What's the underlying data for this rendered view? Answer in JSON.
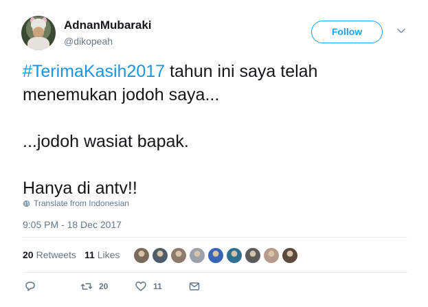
{
  "author": {
    "display_name": "AdnanMubaraki",
    "handle": "@dikopeah"
  },
  "follow_label": "Follow",
  "tweet": {
    "hashtag": "#TerimaKasih2017",
    "line1_rest": " tahun ini saya telah",
    "line2": "menemukan jodoh saya...",
    "line3": "...jodoh wasiat bapak.",
    "line4": "Hanya di antv!!"
  },
  "translate_label": "Translate from Indonesian",
  "timestamp": "9:05 PM - 18 Dec 2017",
  "stats": {
    "retweets_count": "20",
    "retweets_label": "Retweets",
    "likes_count": "11",
    "likes_label": "Likes"
  },
  "liker_avatars": [
    {
      "color": "#7a6a5a"
    },
    {
      "color": "#4e5d6c"
    },
    {
      "color": "#8c7b6b"
    },
    {
      "color": "#9aa3ab"
    },
    {
      "color": "#3a64b5"
    },
    {
      "color": "#2f6f8f"
    },
    {
      "color": "#5b5b5b"
    },
    {
      "color": "#b79a8a"
    },
    {
      "color": "#5a4a3e"
    }
  ],
  "actions": {
    "reply_count": "",
    "retweet_count": "20",
    "like_count": "11"
  },
  "icons": {
    "chevron": "chevron-down-icon",
    "globe": "globe-icon",
    "reply": "reply-icon",
    "retweet": "retweet-icon",
    "like": "heart-icon",
    "message": "envelope-icon"
  },
  "colors": {
    "accent": "#1da1f2",
    "hashtag": "#1b95e0",
    "secondary_text": "#657786",
    "primary_text": "#14171a"
  }
}
